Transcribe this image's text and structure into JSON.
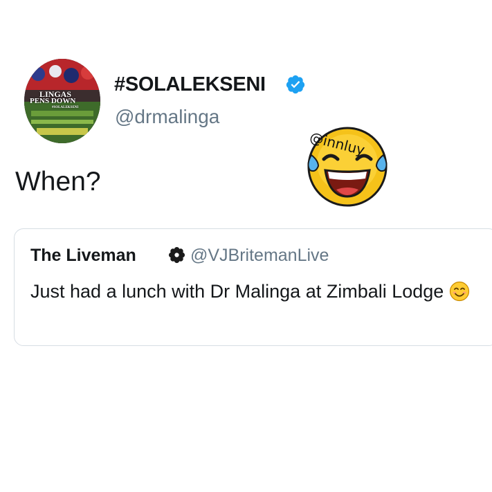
{
  "tweet": {
    "display_name": "#SOLALEKSENI",
    "handle": "@drmalinga",
    "text": "When?",
    "verified": true,
    "avatar": {
      "line1": "LINGAS",
      "line2": "PENS DOWN",
      "line3": "#SOLALEKSENI"
    }
  },
  "sticker": {
    "icon": "face-with-tears-of-joy-icon",
    "watermark": "@innluy"
  },
  "quoted_tweet": {
    "display_name": "The Liveman",
    "badge_icon": "flower-badge-icon",
    "handle": "@VJBritemanLive",
    "text": "Just had a lunch with Dr Malinga at Zimbali Lodge",
    "emoji": "smiling-face-icon"
  },
  "colors": {
    "verified_blue": "#1da1f2",
    "handle_gray": "#657786",
    "card_border": "#d6dde3",
    "text": "#14171a"
  }
}
